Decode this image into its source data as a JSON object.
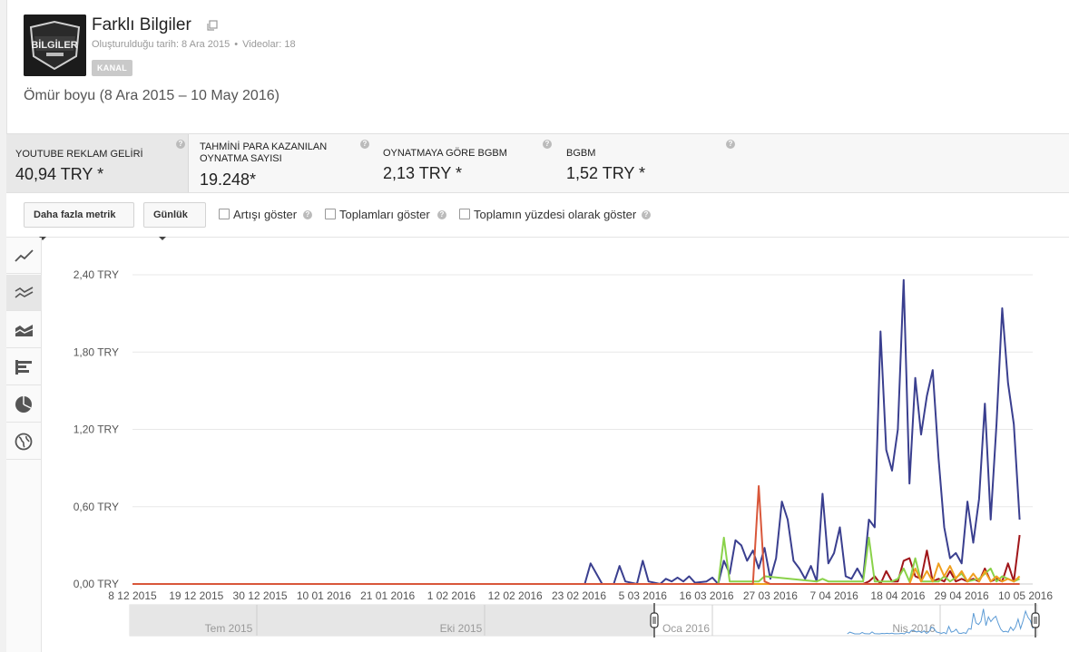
{
  "channel": {
    "title": "Farklı Bilgiler",
    "created": "Oluşturulduğu tarih: 8 Ara 2015",
    "videos": "Videolar: 18",
    "badge": "KANAL",
    "avatar_text": "BİLGİLER"
  },
  "date_range": "Ömür boyu (8 Ara 2015 – 10 May 2016)",
  "metrics": [
    {
      "label": "YOUTUBE REKLAM GELİRİ",
      "value": "40,94 TRY *"
    },
    {
      "label": "TAHMİNİ PARA KAZANILAN OYNATMA SAYISI",
      "value": "19.248*"
    },
    {
      "label": "OYNATMAYA GÖRE BGBM",
      "value": "2,13 TRY *"
    },
    {
      "label": "BGBM",
      "value": "1,52 TRY *"
    }
  ],
  "toolbar": {
    "more_metrics": "Daha fazla metrik",
    "period": "Günlük",
    "show_increase": "Artışı göster",
    "show_totals": "Toplamları göster",
    "show_percent": "Toplamın yüzdesi olarak göster"
  },
  "side_icons": [
    "line-chart-icon",
    "multi-line-icon",
    "stacked-area-icon",
    "bar-chart-icon",
    "pie-chart-icon",
    "globe-icon"
  ],
  "colors": {
    "navy": "#3a3f8f",
    "red_dark": "#a0161a",
    "green": "#8ad24a",
    "orange": "#f0a020",
    "red_peak": "#d9573a",
    "nav_line": "#5c9bd5"
  },
  "chart_data": {
    "type": "line",
    "ylim": [
      0,
      2.4
    ],
    "yticks": [
      "2,40 TRY",
      "1,80 TRY",
      "1,20 TRY",
      "0,60 TRY",
      "0,00 TRY"
    ],
    "xticks": [
      "8 12 2015",
      "19 12 2015",
      "30 12 2015",
      "10 01 2016",
      "21 01 2016",
      "1 02 2016",
      "12 02 2016",
      "23 02 2016",
      "5 03 2016",
      "16 03 2016",
      "27 03 2016",
      "7 04 2016",
      "18 04 2016",
      "29 04 2016",
      "10 05 2016"
    ],
    "navigator_labels": [
      "Tem 2015",
      "Eki 2015",
      "Oca 2016",
      "Nis 2016"
    ],
    "series": [
      {
        "color": "#3a3f8f",
        "points": [
          [
            78,
            0
          ],
          [
            79,
            0.16
          ],
          [
            81,
            0
          ],
          [
            83,
            0
          ],
          [
            84,
            0.14
          ],
          [
            85,
            0.02
          ],
          [
            87,
            0
          ],
          [
            88,
            0.18
          ],
          [
            89,
            0.02
          ],
          [
            91,
            0
          ],
          [
            92,
            0.04
          ],
          [
            93,
            0.02
          ],
          [
            94,
            0.05
          ],
          [
            95,
            0.02
          ],
          [
            96,
            0.06
          ],
          [
            97,
            0.01
          ],
          [
            99,
            0.02
          ],
          [
            100,
            0.05
          ],
          [
            101,
            0
          ],
          [
            102,
            0.18
          ],
          [
            103,
            0.08
          ],
          [
            104,
            0.34
          ],
          [
            105,
            0.3
          ],
          [
            106,
            0.18
          ],
          [
            107,
            0.26
          ],
          [
            108,
            0.12
          ],
          [
            109,
            0.28
          ],
          [
            110,
            0.04
          ],
          [
            111,
            0.2
          ],
          [
            112,
            0.64
          ],
          [
            113,
            0.5
          ],
          [
            114,
            0.18
          ],
          [
            115,
            0.12
          ],
          [
            116,
            0.04
          ],
          [
            117,
            0.14
          ],
          [
            118,
            0.02
          ],
          [
            119,
            0.7
          ],
          [
            120,
            0.16
          ],
          [
            121,
            0.24
          ],
          [
            122,
            0.44
          ],
          [
            123,
            0.06
          ],
          [
            124,
            0.04
          ],
          [
            125,
            0.12
          ],
          [
            126,
            0.04
          ],
          [
            127,
            0.5
          ],
          [
            128,
            0.44
          ],
          [
            129,
            1.96
          ],
          [
            130,
            1.04
          ],
          [
            131,
            0.88
          ],
          [
            132,
            1.2
          ],
          [
            133,
            2.36
          ],
          [
            134,
            0.78
          ],
          [
            135,
            1.6
          ],
          [
            136,
            1.16
          ],
          [
            137,
            1.46
          ],
          [
            138,
            1.66
          ],
          [
            139,
            0.98
          ],
          [
            140,
            0.44
          ],
          [
            141,
            0.2
          ],
          [
            142,
            0.24
          ],
          [
            143,
            0.16
          ],
          [
            144,
            0.64
          ],
          [
            145,
            0.32
          ],
          [
            146,
            0.66
          ],
          [
            147,
            1.4
          ],
          [
            148,
            0.5
          ],
          [
            149,
            1.24
          ],
          [
            150,
            2.14
          ],
          [
            151,
            1.56
          ],
          [
            152,
            1.24
          ],
          [
            153,
            0.5
          ]
        ]
      },
      {
        "color": "#a0161a",
        "points": [
          [
            78,
            0
          ],
          [
            126,
            0
          ],
          [
            127,
            0.02
          ],
          [
            128,
            0.06
          ],
          [
            129,
            0
          ],
          [
            130,
            0.1
          ],
          [
            131,
            0.02
          ],
          [
            132,
            0.02
          ],
          [
            133,
            0.18
          ],
          [
            134,
            0.2
          ],
          [
            135,
            0.06
          ],
          [
            136,
            0.04
          ],
          [
            137,
            0.26
          ],
          [
            138,
            0.02
          ],
          [
            139,
            0.04
          ],
          [
            140,
            0.02
          ],
          [
            141,
            0.1
          ],
          [
            142,
            0.02
          ],
          [
            143,
            0.04
          ],
          [
            144,
            0.02
          ],
          [
            145,
            0.04
          ],
          [
            146,
            0.02
          ],
          [
            147,
            0.12
          ],
          [
            148,
            0.02
          ],
          [
            149,
            0.04
          ],
          [
            150,
            0.02
          ],
          [
            151,
            0.16
          ],
          [
            152,
            0.02
          ],
          [
            153,
            0.38
          ]
        ]
      },
      {
        "color": "#8ad24a",
        "points": [
          [
            78,
            0
          ],
          [
            101,
            0
          ],
          [
            102,
            0.36
          ],
          [
            103,
            0.02
          ],
          [
            108,
            0.02
          ],
          [
            109,
            0.06
          ],
          [
            118,
            0.02
          ],
          [
            119,
            0.04
          ],
          [
            120,
            0.02
          ],
          [
            126,
            0.02
          ],
          [
            127,
            0.36
          ],
          [
            128,
            0.02
          ],
          [
            131,
            0.02
          ],
          [
            132,
            0.04
          ],
          [
            133,
            0.12
          ],
          [
            134,
            0.02
          ],
          [
            135,
            0.2
          ],
          [
            136,
            0.02
          ],
          [
            139,
            0.02
          ],
          [
            140,
            0.06
          ],
          [
            141,
            0.02
          ],
          [
            143,
            0.08
          ],
          [
            144,
            0.02
          ],
          [
            146,
            0.04
          ],
          [
            148,
            0.12
          ],
          [
            149,
            0.02
          ],
          [
            150,
            0.06
          ],
          [
            152,
            0.02
          ],
          [
            153,
            0.04
          ]
        ]
      },
      {
        "color": "#f0a020",
        "points": [
          [
            78,
            0
          ],
          [
            134,
            0
          ],
          [
            135,
            0.12
          ],
          [
            136,
            0.02
          ],
          [
            137,
            0.1
          ],
          [
            138,
            0.02
          ],
          [
            139,
            0.16
          ],
          [
            140,
            0.06
          ],
          [
            141,
            0.14
          ],
          [
            142,
            0.04
          ],
          [
            143,
            0.1
          ],
          [
            144,
            0.02
          ],
          [
            145,
            0.08
          ],
          [
            146,
            0.02
          ],
          [
            147,
            0.1
          ],
          [
            148,
            0.02
          ],
          [
            149,
            0.06
          ],
          [
            150,
            0.02
          ],
          [
            151,
            0.04
          ],
          [
            152,
            0.02
          ],
          [
            153,
            0.06
          ]
        ]
      },
      {
        "color": "#d9573a",
        "points": [
          [
            0,
            0
          ],
          [
            107,
            0
          ],
          [
            108,
            0.76
          ],
          [
            109,
            0.02
          ],
          [
            110,
            0
          ],
          [
            153,
            0
          ]
        ]
      }
    ]
  }
}
